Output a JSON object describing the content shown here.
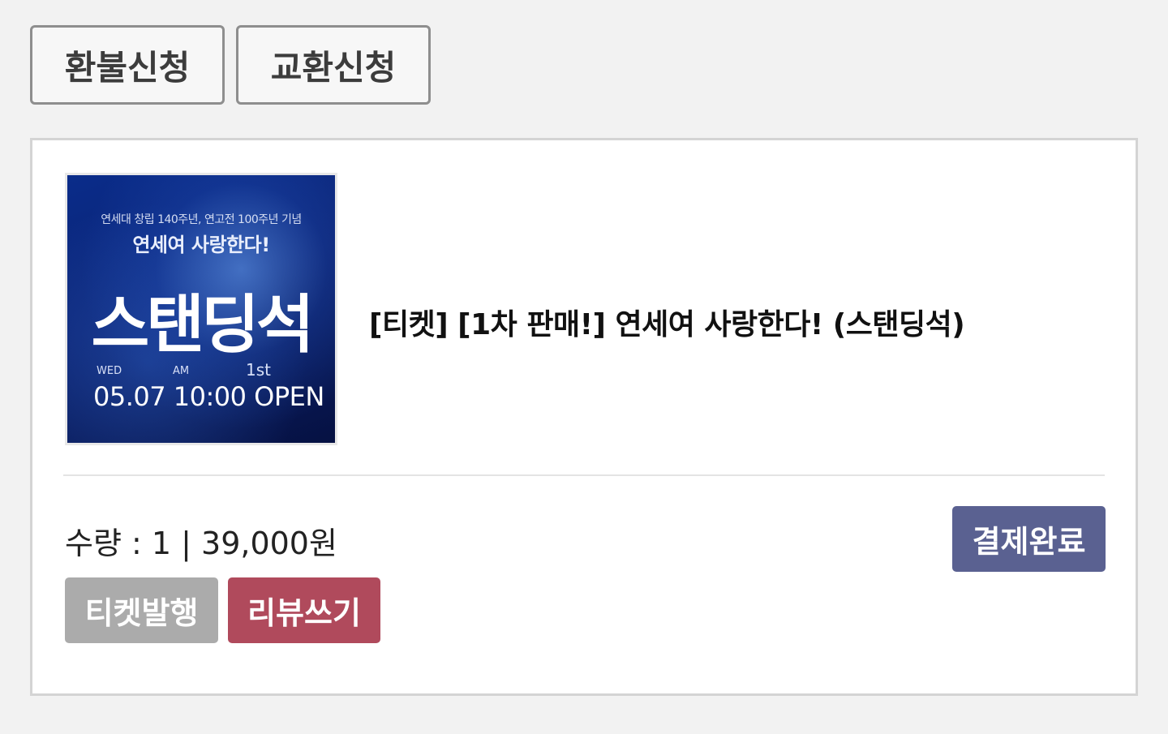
{
  "actions": {
    "refund_label": "환불신청",
    "exchange_label": "교환신청"
  },
  "order": {
    "poster": {
      "subtitle": "연세대 창립 140주년, 연고전 100주년 기념",
      "headline": "연세여 사랑한다!",
      "big_text": "스탠딩석",
      "day": "WED",
      "ampm": "AM",
      "round": "1st",
      "open_text": "05.07 10:00 OPEN"
    },
    "title": "[티켓] [1차 판매!] 연세여 사랑한다! (스탠딩석)",
    "quantity_price": "수량 : 1 | 39,000원",
    "status": "결제완료",
    "issue_ticket_label": "티켓발행",
    "write_review_label": "리뷰쓰기"
  },
  "colors": {
    "page_bg": "#f2f2f2",
    "status_badge": "#5a6191",
    "issue_button": "#ababab",
    "review_button": "#b04a5c"
  }
}
